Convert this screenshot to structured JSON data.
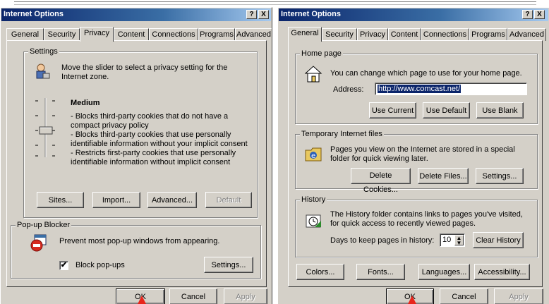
{
  "left": {
    "title": "Internet Options",
    "tabs": [
      "General",
      "Security",
      "Privacy",
      "Content",
      "Connections",
      "Programs",
      "Advanced"
    ],
    "active_tab": "Privacy",
    "settings": {
      "legend": "Settings",
      "intro": "Move the slider to select a privacy setting for the Internet zone.",
      "level": "Medium",
      "bullets": [
        "- Blocks third-party cookies that do not have a compact privacy policy",
        "- Blocks third-party cookies that use personally identifiable information without your implicit consent",
        "- Restricts first-party cookies that use personally identifiable information without implicit consent"
      ],
      "buttons": {
        "sites": "Sites...",
        "import": "Import...",
        "advanced": "Advanced...",
        "default": "Default"
      }
    },
    "popup": {
      "legend": "Pop-up Blocker",
      "description": "Prevent most pop-up windows from appearing.",
      "checkbox_label": "Block pop-ups",
      "checked": true,
      "settings_button": "Settings..."
    },
    "footer": {
      "ok": "OK",
      "cancel": "Cancel",
      "apply": "Apply"
    }
  },
  "right": {
    "title": "Internet Options",
    "tabs": [
      "General",
      "Security",
      "Privacy",
      "Content",
      "Connections",
      "Programs",
      "Advanced"
    ],
    "active_tab": "General",
    "homepage": {
      "legend": "Home page",
      "description": "You can change which page to use for your home page.",
      "address_label": "Address:",
      "address_value": "http://www.comcast.net/",
      "buttons": {
        "current": "Use Current",
        "default": "Use Default",
        "blank": "Use Blank"
      }
    },
    "temp_files": {
      "legend": "Temporary Internet files",
      "description": "Pages you view on the Internet are stored in a special folder for quick viewing later.",
      "buttons": {
        "cookies": "Delete Cookies...",
        "files": "Delete Files...",
        "settings": "Settings..."
      }
    },
    "history": {
      "legend": "History",
      "description": "The History folder contains links to pages you've visited, for quick access to recently viewed pages.",
      "days_label": "Days to keep pages in history:",
      "days_value": "10",
      "clear_button": "Clear History"
    },
    "bottom_buttons": {
      "colors": "Colors...",
      "fonts": "Fonts...",
      "languages": "Languages...",
      "accessibility": "Accessibility..."
    },
    "footer": {
      "ok": "OK",
      "cancel": "Cancel",
      "apply": "Apply"
    }
  },
  "title_buttons": {
    "help": "?",
    "close": "X"
  },
  "colors": {
    "titlebar": "#0a246a",
    "face": "#d4d0c8",
    "arrow": "#e8261c"
  }
}
